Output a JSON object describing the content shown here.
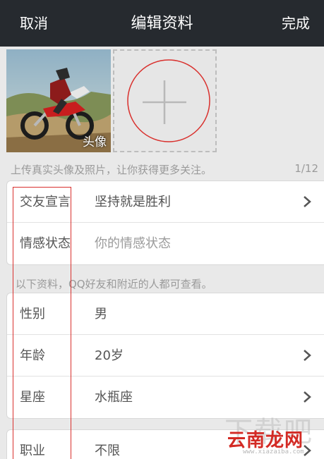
{
  "header": {
    "cancel_label": "取消",
    "title": "编辑资料",
    "done_label": "完成"
  },
  "photos": {
    "avatar_label": "头像",
    "hint": "上传真实头像及照片，让你获得更多关注。",
    "count": "1/12"
  },
  "profile_group": {
    "rows": [
      {
        "label": "交友宣言",
        "value": "坚持就是胜利",
        "has_chevron": true
      },
      {
        "label": "情感状态",
        "value": "你的情感状态",
        "placeholder": true,
        "has_chevron": false
      }
    ]
  },
  "section_note": "以下资料，QQ好友和附近的人都可查看。",
  "info_group": {
    "rows": [
      {
        "label": "性别",
        "value": "男",
        "has_chevron": false
      },
      {
        "label": "年龄",
        "value": "20岁",
        "has_chevron": true
      },
      {
        "label": "星座",
        "value": "水瓶座",
        "has_chevron": true
      }
    ]
  },
  "work_group": {
    "rows": [
      {
        "label": "职业",
        "value": "不限",
        "has_chevron": true
      }
    ]
  },
  "watermark": {
    "text": "云南龙网",
    "url": "www.xiazaiba.com"
  },
  "colors": {
    "header_bg": "#262a2f",
    "page_bg": "#e9e9e9",
    "annotation_red": "#d9302d"
  }
}
